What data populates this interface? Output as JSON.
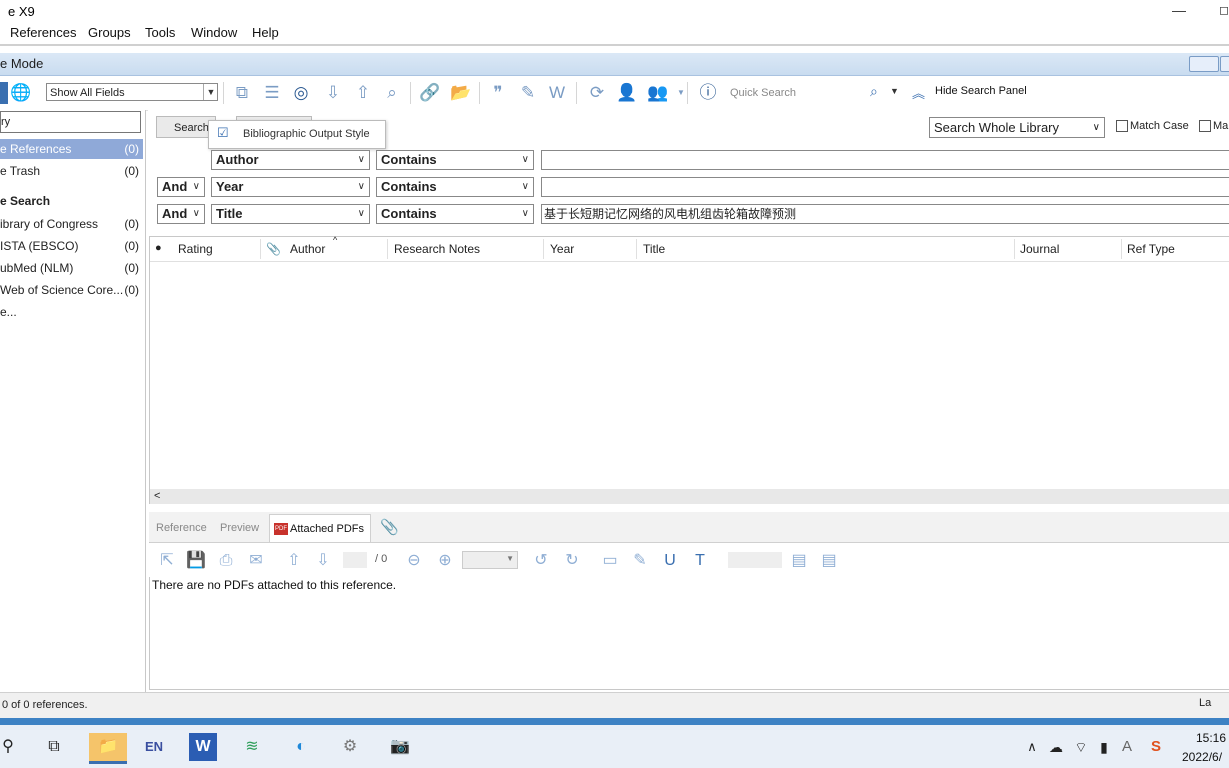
{
  "window": {
    "title": "e X9"
  },
  "menu": [
    "References",
    "Groups",
    "Tools",
    "Window",
    "Help"
  ],
  "mode": {
    "title": "e Mode"
  },
  "toolbar": {
    "fields_select": "Show All Fields",
    "quick_search_placeholder": "Quick Search",
    "hide_search_panel": "Hide Search Panel"
  },
  "tooltip": {
    "text": "Bibliographic Output Style"
  },
  "left_panel": {
    "input_value": "ry",
    "items": [
      {
        "label": "e References",
        "count": "(0)"
      },
      {
        "label": "e Trash",
        "count": "(0)"
      }
    ],
    "online_header": "e Search",
    "online": [
      {
        "label": "ibrary of Congress",
        "count": "(0)"
      },
      {
        "label": "ISTA (EBSCO)",
        "count": "(0)"
      },
      {
        "label": "ubMed (NLM)",
        "count": "(0)"
      },
      {
        "label": "Web of Science Core...",
        "count": "(0)"
      }
    ],
    "more": "e..."
  },
  "search": {
    "button": "Search",
    "scope": "Search Whole Library",
    "match_case": "Match Case",
    "match_words": "Ma",
    "rows": [
      {
        "bool": "",
        "field": "Author",
        "op": "Contains",
        "value": ""
      },
      {
        "bool": "And",
        "field": "Year",
        "op": "Contains",
        "value": ""
      },
      {
        "bool": "And",
        "field": "Title",
        "op": "Contains",
        "value": "基于长短期记忆网络的风电机组齿轮箱故障预测"
      }
    ]
  },
  "list": {
    "columns": [
      "Rating",
      "Author",
      "Research Notes",
      "Year",
      "Title",
      "Journal",
      "Ref Type"
    ]
  },
  "bottom": {
    "tabs": [
      "Reference",
      "Preview",
      "Attached PDFs"
    ],
    "page_total": "/ 0",
    "message": "There are no PDFs attached to this reference."
  },
  "status": {
    "text": "0 of 0 references.",
    "right": "La"
  },
  "clock": {
    "time": "15:16",
    "date": "2022/6/"
  }
}
